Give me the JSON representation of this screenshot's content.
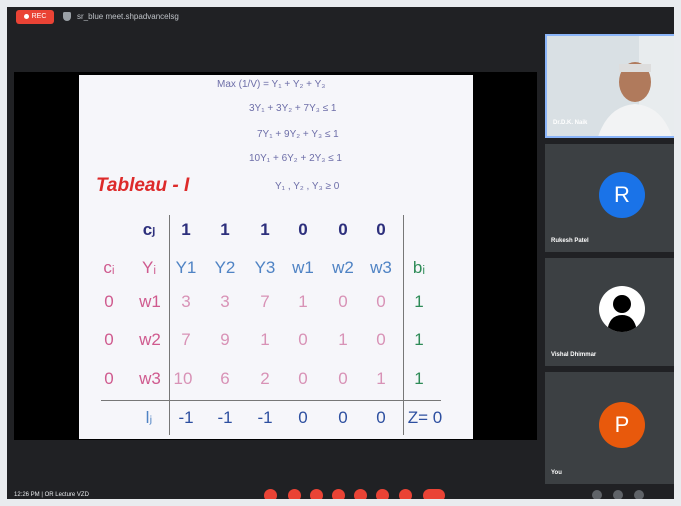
{
  "topbar": {
    "rec_label": "REC",
    "title": "sr_blue meet.shpadvancelsg"
  },
  "slide": {
    "equations": [
      "Max (1/V) =  Y₁ + Y₂ + Y₃",
      "3Y₁ + 3Y₂ +   7Y₃  ≤  1",
      "7Y₁ + 9Y₂ + Y₃  ≤  1",
      "10Y₁ + 6Y₂ + 2Y₃  ≤  1",
      "Y₁  , Y₂  , Y₃  ≥  0"
    ],
    "tableau_title": "Tableau - I",
    "cj_label": "cⱼ",
    "cj_values": [
      "1",
      "1",
      "1",
      "0",
      "0",
      "0"
    ],
    "ci_header": "cᵢ",
    "yi_header": "Yᵢ",
    "col_headers": [
      "Y1",
      "Y2",
      "Y3",
      "w1",
      "w2",
      "w3"
    ],
    "bi_header": "bᵢ",
    "rows": [
      {
        "ci": "0",
        "yi": "w1",
        "vals": [
          "3",
          "3",
          "7",
          "1",
          "0",
          "0"
        ],
        "bi": "1"
      },
      {
        "ci": "0",
        "yi": "w2",
        "vals": [
          "7",
          "9",
          "1",
          "0",
          "1",
          "0"
        ],
        "bi": "1"
      },
      {
        "ci": "0",
        "yi": "w3",
        "vals": [
          "10",
          "6",
          "2",
          "0",
          "0",
          "1"
        ],
        "bi": "1"
      }
    ],
    "lj_label": "lⱼ",
    "lj_values": [
      "-1",
      "-1",
      "-1",
      "0",
      "0",
      "0"
    ],
    "z_label": "Z= 0"
  },
  "participants": [
    {
      "name": "Dr.D.K. Naik",
      "initial": "",
      "color": "#5f6368"
    },
    {
      "name": "Rukesh Patel",
      "initial": "R",
      "color": "#1a73e8"
    },
    {
      "name": "Vishal Dhimmar",
      "initial": "",
      "color": "#ffffff"
    },
    {
      "name": "You",
      "initial": "P",
      "color": "#e8590c"
    }
  ],
  "bottombar": {
    "meeting_info": "12:26 PM  |  OR Lecture VZD"
  },
  "icons": [
    "shield-icon",
    "mic-off-icon",
    "camera-off-icon",
    "captions-icon",
    "raise-hand-icon",
    "present-icon",
    "more-icon",
    "leave-call-icon",
    "info-icon",
    "people-icon",
    "chat-icon"
  ]
}
